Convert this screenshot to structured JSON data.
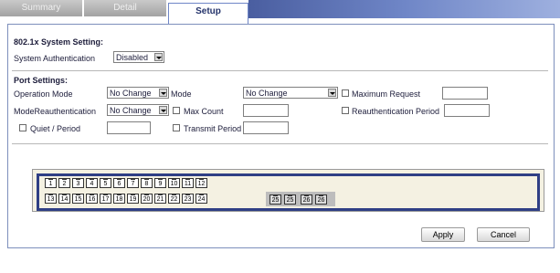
{
  "tabs": [
    {
      "label": "Summary",
      "active": false
    },
    {
      "label": "Detail",
      "active": false
    },
    {
      "label": "Setup",
      "active": true
    }
  ],
  "system_setting": {
    "title": "802.1x System Setting:",
    "auth_label": "System Authentication",
    "auth_value": "Disabled"
  },
  "port_settings": {
    "title": "Port Settings:",
    "operation_mode_label": "Operation Mode",
    "operation_mode_value": "No Change",
    "mode_label": "Mode",
    "mode_value": "No Change",
    "max_request_label": "Maximum Request",
    "mode_reauth_label": "ModeReauthentication",
    "mode_reauth_value": "No Change",
    "max_count_label": "Max Count",
    "reauth_period_label": "Reauthentication Period",
    "quiet_period_label": "Quiet / Period",
    "transmit_period_label": "Transmit Period"
  },
  "ports": {
    "row1": [
      "1",
      "2",
      "3",
      "4",
      "5",
      "6",
      "7",
      "8",
      "9",
      "10",
      "11",
      "12"
    ],
    "row2": [
      "13",
      "14",
      "15",
      "16",
      "17",
      "18",
      "19",
      "20",
      "21",
      "22",
      "23",
      "24"
    ],
    "fiber": [
      "25",
      "25",
      "26",
      "26"
    ]
  },
  "buttons": {
    "apply": "Apply",
    "cancel": "Cancel"
  },
  "colors": {
    "tab_active_text": "#24336b",
    "panel_border": "#7d8fbc",
    "port_frame": "#2f3f85"
  }
}
